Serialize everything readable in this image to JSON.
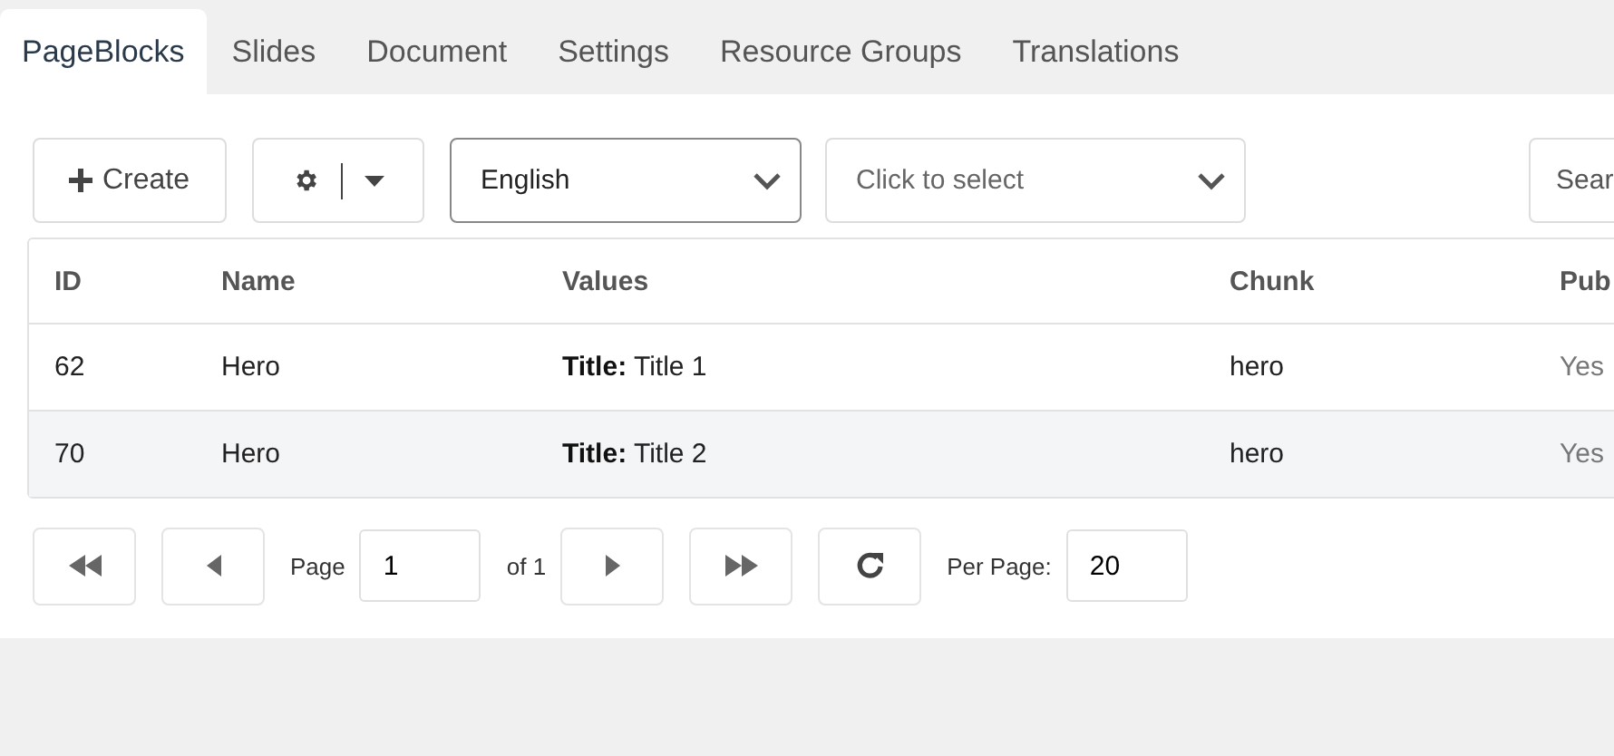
{
  "tabs": [
    {
      "label": "PageBlocks",
      "selected": true
    },
    {
      "label": "Slides",
      "selected": false
    },
    {
      "label": "Document",
      "selected": false
    },
    {
      "label": "Settings",
      "selected": false
    },
    {
      "label": "Resource Groups",
      "selected": false
    },
    {
      "label": "Translations",
      "selected": false
    }
  ],
  "toolbar": {
    "create_label": "Create",
    "language": {
      "value": "English"
    },
    "filter": {
      "placeholder": "Click to select"
    },
    "search": {
      "placeholder": "Sear"
    }
  },
  "table": {
    "columns": [
      "ID",
      "Name",
      "Values",
      "Chunk",
      "Pub"
    ],
    "rows": [
      {
        "id": "62",
        "name": "Hero",
        "values": "**Title:** Title 1",
        "chunk": "hero",
        "published": "Yes"
      },
      {
        "id": "70",
        "name": "Hero",
        "values": "**Title:** Title 2",
        "chunk": "hero",
        "published": "Yes"
      }
    ]
  },
  "pagination": {
    "page_label": "Page",
    "page": "1",
    "of_label": "of 1",
    "per_page_label": "Per Page:",
    "per_page": "20"
  }
}
